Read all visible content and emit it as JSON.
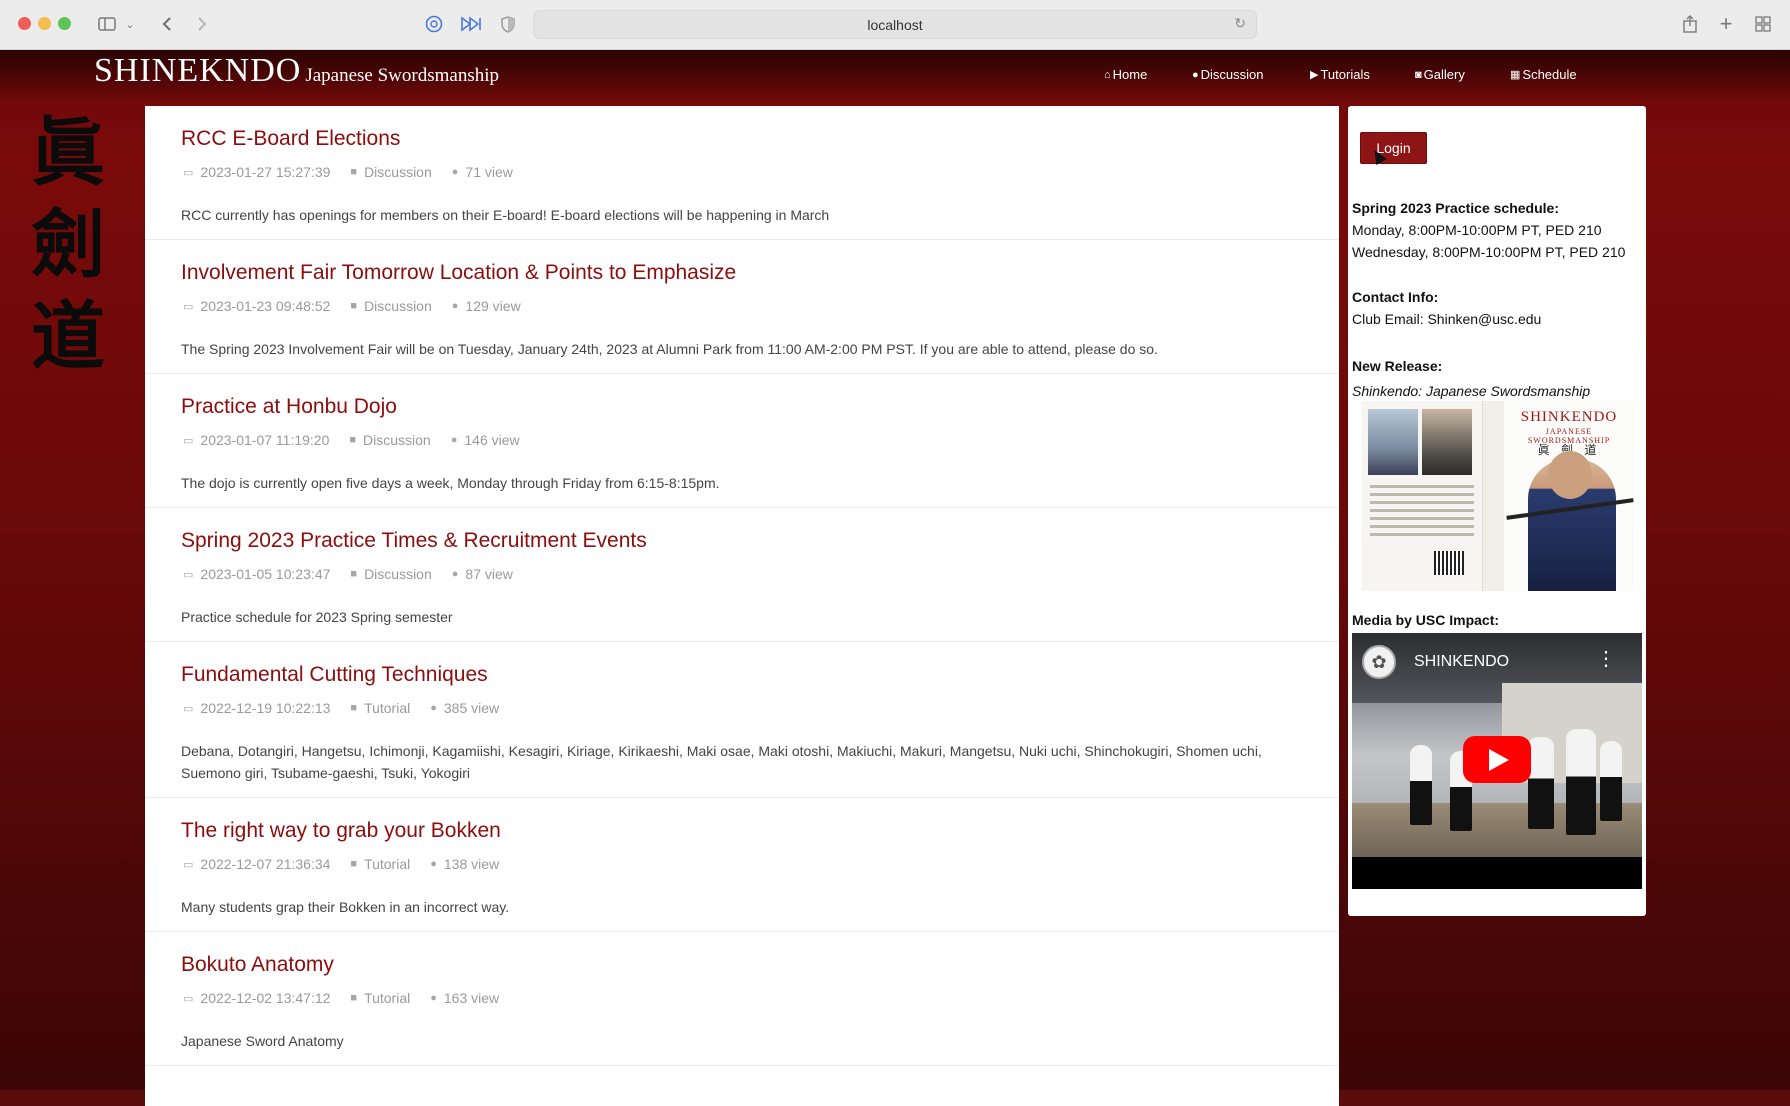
{
  "browser": {
    "url": "localhost",
    "icons": [
      "sidebar-toggle-icon",
      "chevron-down-icon",
      "back-icon",
      "forward-icon",
      "extension-icon",
      "media-icon",
      "privacy-shield-icon",
      "reload-icon",
      "share-icon",
      "new-tab-icon",
      "tab-overview-icon"
    ]
  },
  "site": {
    "brand_main": "SHINEKNDO",
    "brand_sub": "Japanese Swordsmanship",
    "kanji": [
      "眞",
      "劍",
      "道"
    ],
    "nav": [
      {
        "icon": "⌂",
        "label": "Home"
      },
      {
        "icon": "●",
        "label": "Discussion"
      },
      {
        "icon": "▶",
        "label": "Tutorials"
      },
      {
        "icon": "◙",
        "label": "Gallery"
      },
      {
        "icon": "▦",
        "label": "Schedule"
      }
    ]
  },
  "posts": [
    {
      "title": "RCC E-Board Elections",
      "date": "2023-01-27 15:27:39",
      "category": "Discussion",
      "views": "71 view",
      "excerpt": "RCC currently has openings for members on their E-board! E-board elections will be happening in March"
    },
    {
      "title": "Involvement Fair Tomorrow Location & Points to Emphasize",
      "date": "2023-01-23 09:48:52",
      "category": "Discussion",
      "views": "129 view",
      "excerpt": "The Spring 2023 Involvement Fair will be on Tuesday, January 24th, 2023 at Alumni Park from 11:00 AM-2:00 PM PST. If you are able to attend, please do so."
    },
    {
      "title": "Practice at Honbu Dojo",
      "date": "2023-01-07 11:19:20",
      "category": "Discussion",
      "views": "146 view",
      "excerpt": "The dojo is currently open five days a week, Monday through Friday from 6:15-8:15pm."
    },
    {
      "title": "Spring 2023 Practice Times & Recruitment Events",
      "date": "2023-01-05 10:23:47",
      "category": "Discussion",
      "views": "87 view",
      "excerpt": "Practice schedule for 2023 Spring semester"
    },
    {
      "title": "Fundamental Cutting Techniques",
      "date": "2022-12-19 10:22:13",
      "category": "Tutorial",
      "views": "385 view",
      "excerpt": "Debana, Dotangiri, Hangetsu, Ichimonji, Kagamiishi, Kesagiri, Kiriage, Kirikaeshi, Maki osae, Maki otoshi, Makiuchi, Makuri, Mangetsu, Nuki uchi, Shinchokugiri, Shomen uchi, Suemono giri, Tsubame-gaeshi, Tsuki, Yokogiri"
    },
    {
      "title": "The right way to grab your Bokken",
      "date": "2022-12-07 21:36:34",
      "category": "Tutorial",
      "views": "138 view",
      "excerpt": "Many students grap their Bokken in an incorrect way."
    },
    {
      "title": "Bokuto Anatomy",
      "date": "2022-12-02 13:47:12",
      "category": "Tutorial",
      "views": "163 view",
      "excerpt": "Japanese Sword Anatomy"
    }
  ],
  "sidebar": {
    "login_label": "Login",
    "schedule_heading": "Spring 2023 Practice schedule:",
    "schedule_lines": [
      "Monday, 8:00PM-10:00PM PT, PED 210",
      "Wednesday, 8:00PM-10:00PM PT, PED 210"
    ],
    "contact_heading": "Contact Info:",
    "contact_line": "Club Email: Shinken@usc.edu",
    "release_heading": "New Release:",
    "release_title": "Shinkendo: Japanese Swordsmanship",
    "book_cover_title": "SHINKENDO",
    "book_cover_sub": "JAPANESE SWORDSMANSHIP",
    "book_cover_kanji": "眞 劍 道",
    "media_heading": "Media by USC Impact:",
    "video_title": "SHINKENDO"
  },
  "colors": {
    "accent": "#8b0d0d",
    "nav_bg": "#4e0606",
    "button": "#8e1515",
    "play": "#ff0000"
  }
}
